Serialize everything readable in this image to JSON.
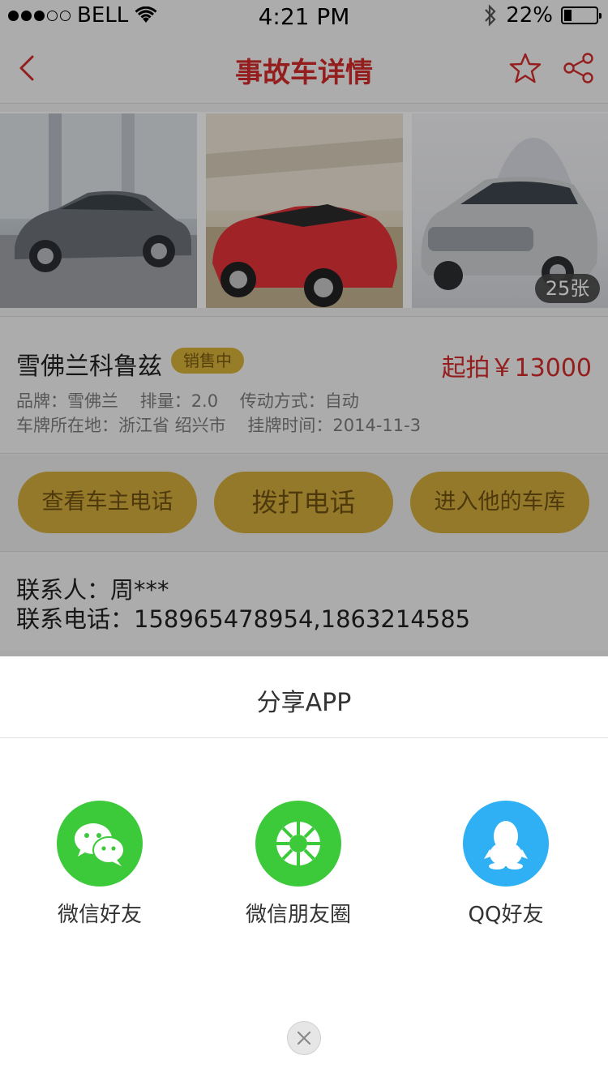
{
  "status_bar": {
    "carrier": "BELL",
    "time": "4:21 PM",
    "battery": "22%",
    "battery_level": 0.22
  },
  "nav": {
    "title": "事故车详情",
    "back_icon": "chevron-left-icon",
    "favorite_icon": "star-icon",
    "share_icon": "share-icon"
  },
  "gallery": {
    "count_label": "25张",
    "photos": [
      "gray-sedan-photo",
      "red-convertible-photo",
      "silver-sedan-photo"
    ]
  },
  "car": {
    "name": "雪佛兰科鲁兹",
    "status_badge": "销售中",
    "price": "起拍￥13000",
    "specs_line1": "品牌：雪佛兰    排量：2.0    传动方式：自动",
    "specs_line2": "车牌所在地：浙江省 绍兴市    挂牌时间：2014-11-3"
  },
  "actions": {
    "view_phone": "查看车主电话",
    "call": "拨打电话",
    "garage": "进入他的车库"
  },
  "contact": {
    "person": "联系人：周***",
    "phone": "联系电话：158965478954,1863214585"
  },
  "share_sheet": {
    "title": "分享APP",
    "options": [
      {
        "label": "微信好友",
        "icon": "wechat-icon",
        "color": "#3cc93a"
      },
      {
        "label": "微信朋友圈",
        "icon": "wechat-moments-icon",
        "color": "#3cc93a"
      },
      {
        "label": "QQ好友",
        "icon": "qq-icon",
        "color": "#2fb0f4"
      }
    ],
    "close_icon": "close-icon"
  },
  "colors": {
    "accent_red": "#d52b2b",
    "button_gold": "#d6ae3e"
  }
}
